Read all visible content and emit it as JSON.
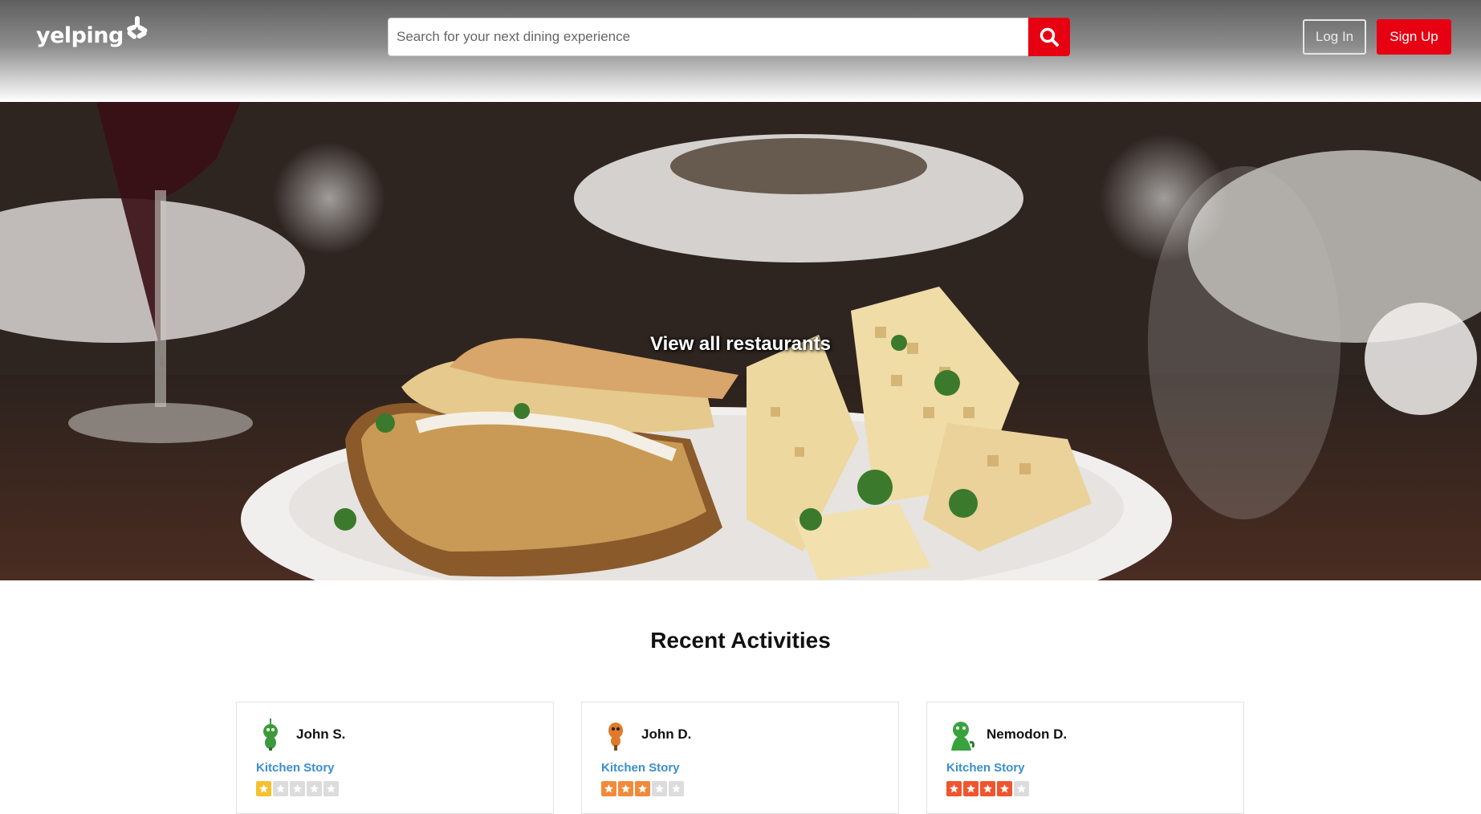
{
  "header": {
    "logo_text": "yelping",
    "search": {
      "placeholder": "Search for your next dining experience",
      "value": ""
    },
    "login_label": "Log In",
    "signup_label": "Sign Up"
  },
  "hero": {
    "link_label": "View all restaurants"
  },
  "recent": {
    "title": "Recent Activities",
    "cards": [
      {
        "user": "John S.",
        "business": "Kitchen Story",
        "rating": 1,
        "avatar_color": "#3d9a3a"
      },
      {
        "user": "John D.",
        "business": "Kitchen Story",
        "rating": 3,
        "avatar_color": "#e07a2a"
      },
      {
        "user": "Nemodon D.",
        "business": "Kitchen Story",
        "rating": 4,
        "avatar_color": "#3aa23d"
      }
    ]
  },
  "colors": {
    "brand_red": "#e60012",
    "link_blue": "#3a8ed3",
    "star_1": "#f5c12e",
    "star_3": "#f28a3c",
    "star_4": "#f0552d",
    "star_empty": "#dcdcdc"
  }
}
